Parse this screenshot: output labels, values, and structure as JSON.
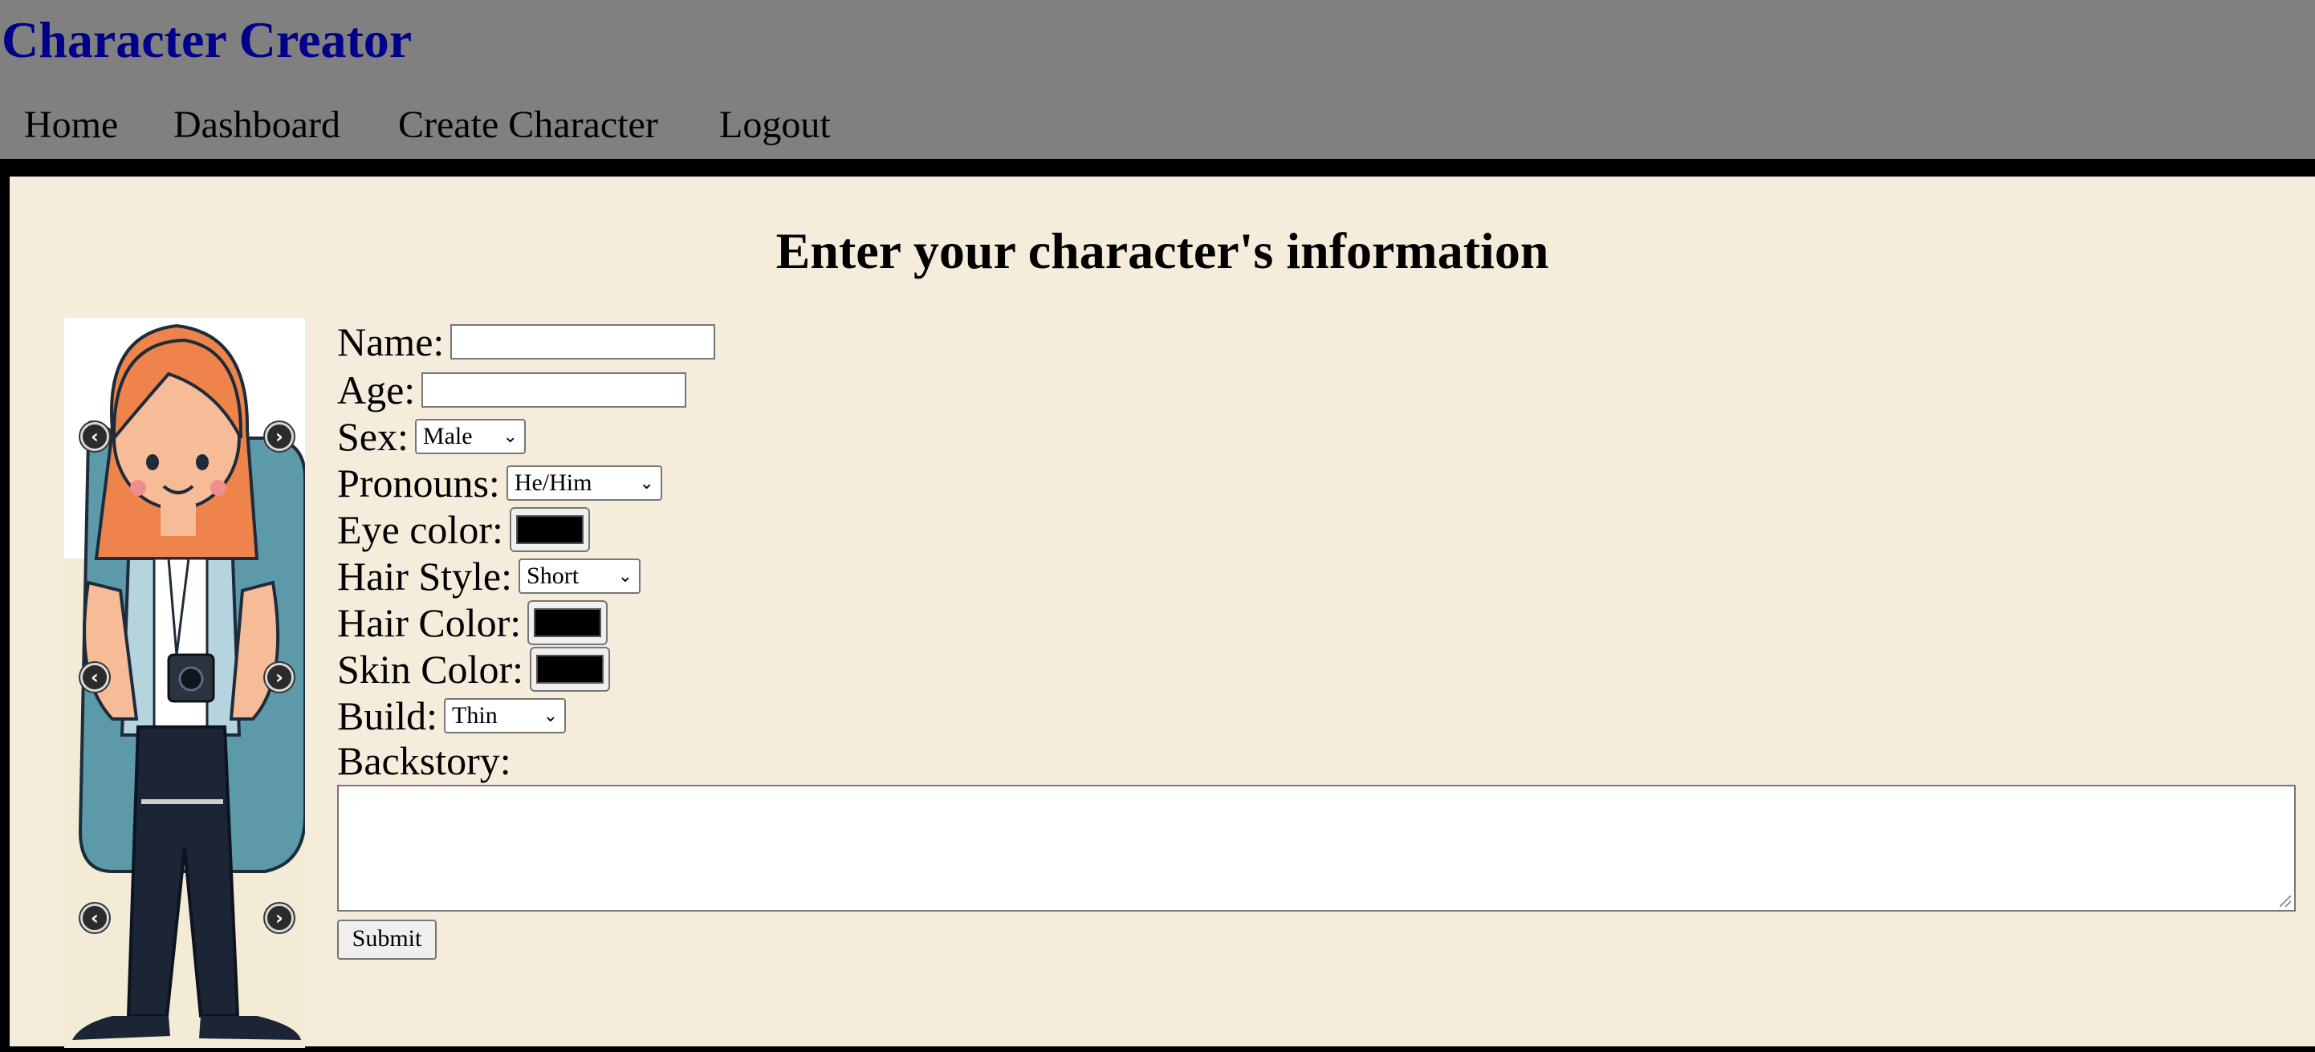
{
  "header": {
    "title": "Character Creator",
    "nav": [
      {
        "label": "Home"
      },
      {
        "label": "Dashboard"
      },
      {
        "label": "Create Character"
      },
      {
        "label": "Logout"
      }
    ]
  },
  "main": {
    "title": "Enter your character's information",
    "preview": {
      "prev_icon": "chevron-left-icon",
      "next_icon": "chevron-right-icon"
    },
    "form": {
      "name_label": "Name:",
      "name_value": "",
      "age_label": "Age:",
      "age_value": "",
      "sex_label": "Sex:",
      "sex_value": "Male",
      "pronouns_label": "Pronouns:",
      "pronouns_value": "He/Him",
      "eye_color_label": "Eye color:",
      "eye_color_value": "#000000",
      "hair_style_label": "Hair Style:",
      "hair_style_value": "Short",
      "hair_color_label": "Hair Color:",
      "hair_color_value": "#000000",
      "skin_color_label": "Skin Color:",
      "skin_color_value": "#000000",
      "build_label": "Build:",
      "build_value": "Thin",
      "backstory_label": "Backstory:",
      "backstory_value": "",
      "submit_label": "Submit"
    }
  },
  "colors": {
    "header_bg": "#808080",
    "title_color": "#00008b",
    "page_bg": "#f6ecdc",
    "frame": "#000000"
  }
}
